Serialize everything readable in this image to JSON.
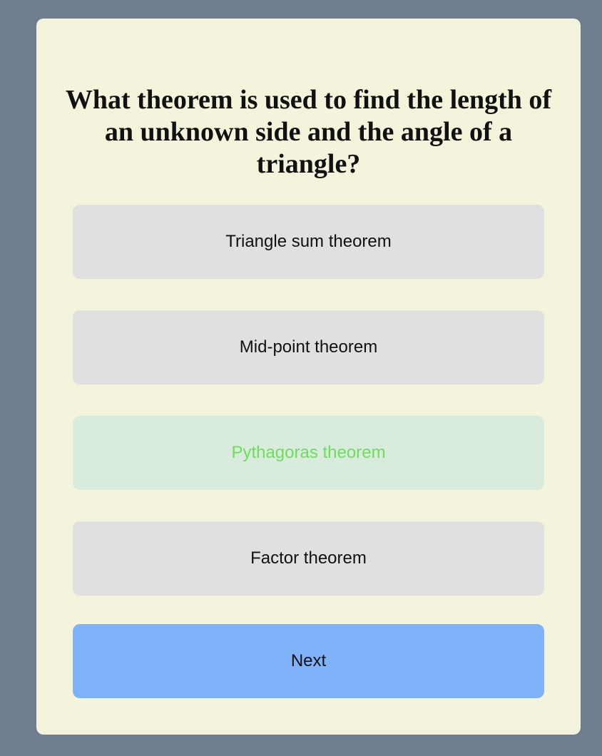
{
  "quiz": {
    "question": "What theorem is used to find the length of an unknown side and the angle of a triangle?",
    "answers": [
      {
        "label": "Triangle sum theorem",
        "state": "default"
      },
      {
        "label": "Mid-point theorem",
        "state": "default"
      },
      {
        "label": "Pythagoras theorem",
        "state": "correct"
      },
      {
        "label": "Factor theorem",
        "state": "default"
      }
    ],
    "next_label": "Next"
  },
  "colors": {
    "page_background": "#6f7d8f",
    "card_background": "#f4f4dd",
    "answer_background": "#e0e0e0",
    "correct_background": "#d9ebdc",
    "correct_text": "#6dde5b",
    "next_background": "#7fb2f8"
  }
}
